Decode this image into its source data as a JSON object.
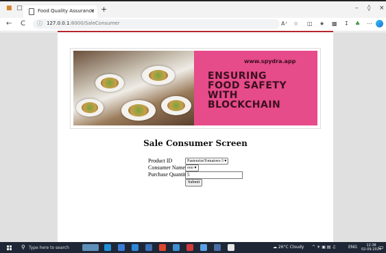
{
  "browser": {
    "tab_title": "Food Quality Assurance",
    "tab_close": "×",
    "new_tab": "+",
    "url_host": "127.0.0.1",
    "url_path": ":8000/SaleConsumer",
    "back": "←",
    "reload": "C",
    "minimize": "–",
    "restore": "◊",
    "close": "×"
  },
  "banner": {
    "site": "www.spydra.app",
    "slogan_lines": [
      "ENSURING",
      "FOOD SAFETY",
      "WITH",
      "BLOCKCHAIN"
    ]
  },
  "page": {
    "heading": "Sale Consumer Screen"
  },
  "form": {
    "product_id_label": "Product ID",
    "product_id_value": "PasteurizeTomatoes-3",
    "consumer_name_label": "Consumer Name",
    "consumer_name_value": "ooo",
    "purchase_quantity_label": "Purchase Quantity",
    "purchase_quantity_value": "5",
    "submit_label": "Submit"
  },
  "taskbar": {
    "search_placeholder": "Type here to search",
    "weather": "26°C  Cloudy",
    "language": "ENG",
    "time": "12:38",
    "date": "02-09-2024"
  },
  "colors": {
    "banner_bg": "#e64b8a",
    "slogan": "#3a0f1e",
    "accent_line": "#b5242c",
    "taskbar": "#1f2736"
  }
}
